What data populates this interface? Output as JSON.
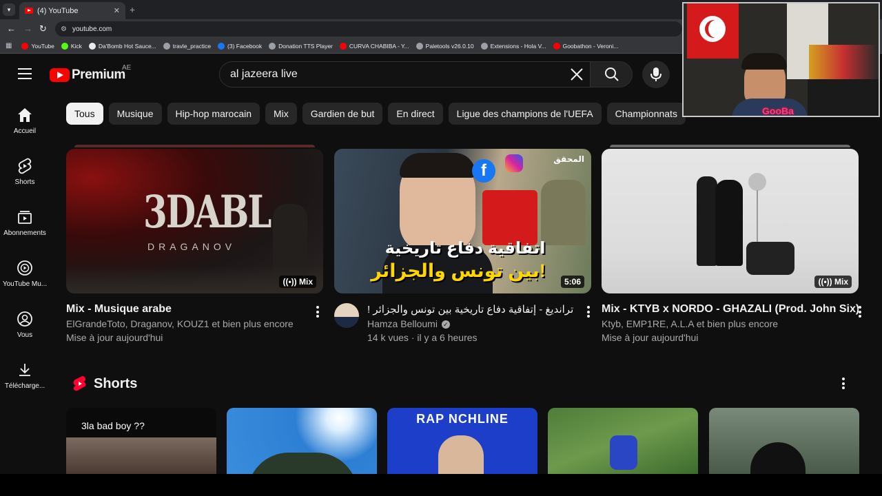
{
  "browser": {
    "tab_title": "(4) YouTube",
    "tab_close": "✕",
    "new_tab": "+",
    "url": "youtube.com",
    "bookmarks": [
      {
        "label": "YouTube",
        "color": "#ff0000"
      },
      {
        "label": "Kick",
        "color": "#53fc18"
      },
      {
        "label": "Da'Bomb Hot Sauce...",
        "color": "#e8eaed"
      },
      {
        "label": "travle_practice",
        "color": "#9aa0a6"
      },
      {
        "label": "(3) Facebook",
        "color": "#1877f2"
      },
      {
        "label": "Donation TTS Player",
        "color": "#9aa0a6"
      },
      {
        "label": "CURVA CHABIBA - Y...",
        "color": "#ff0000"
      },
      {
        "label": "Paletools v26.0.10",
        "color": "#9aa0a6"
      },
      {
        "label": "Extensions - Hola V...",
        "color": "#9aa0a6"
      },
      {
        "label": "Goobathon - Veroni...",
        "color": "#ff0000"
      }
    ]
  },
  "masthead": {
    "logo_text": "Premium",
    "country": "AE",
    "search_value": "al jazeera live"
  },
  "sidebar": {
    "items": [
      {
        "label": "Accueil",
        "icon": "home-icon"
      },
      {
        "label": "Shorts",
        "icon": "shorts-icon"
      },
      {
        "label": "Abonnements",
        "icon": "subscriptions-icon"
      },
      {
        "label": "YouTube Mu...",
        "icon": "youtube-music-icon"
      },
      {
        "label": "Vous",
        "icon": "you-icon"
      },
      {
        "label": "Télécharge...",
        "icon": "download-icon"
      }
    ]
  },
  "chips": [
    "Tous",
    "Musique",
    "Hip-hop marocain",
    "Mix",
    "Gardien de but",
    "En direct",
    "Ligue des champions de l'UEFA",
    "Championnats"
  ],
  "videos": [
    {
      "thumb_text": "3DABL",
      "thumb_sub": "DRAGANOV",
      "badge": "Mix",
      "title": "Mix - Musique arabe",
      "line1": "ElGrandeToto, Draganov, KOUZ1 et bien plus encore",
      "line2": "Mise à jour aujourd'hui"
    },
    {
      "thumb_text_top": "اتفاقية دفاع تاريخية",
      "thumb_text_bottom": "بين تونس والجزائر!",
      "thumb_corner": "المحقق",
      "badge": "5:06",
      "title": "! ترانديغ - إتفاقية دفاع تاريخية بين تونس والجزائر",
      "channel": "Hamza Belloumi",
      "meta": "14 k vues · il y a 6 heures"
    },
    {
      "badge": "Mix",
      "title": "Mix - KTYB x NORDO - GHAZALI (Prod. John Six)",
      "line1": "Ktyb, EMP1RE, A.L.A et bien plus encore",
      "line2": "Mise à jour aujourd'hui"
    }
  ],
  "shorts": {
    "title": "Shorts",
    "items": [
      {
        "overlay": "3la bad boy ??"
      },
      {
        "overlay": ""
      },
      {
        "overlay": "RAP  NCHLINE"
      },
      {
        "overlay": ""
      },
      {
        "overlay": ""
      }
    ]
  },
  "webcam": {
    "name_tag": "GooBa"
  }
}
